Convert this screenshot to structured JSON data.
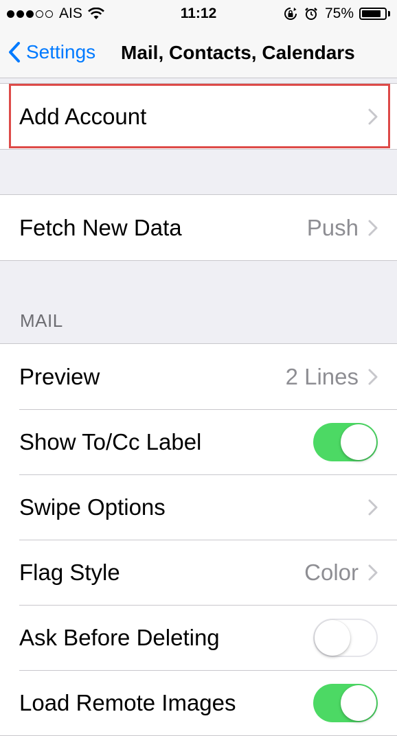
{
  "status_bar": {
    "carrier": "AIS",
    "time": "11:12",
    "battery": "75%",
    "signal_icon": "signal-dots",
    "wifi_icon": "wifi-icon",
    "lock_rotation_icon": "rotation-lock-icon",
    "alarm_icon": "alarm-icon"
  },
  "nav": {
    "back_label": "Settings",
    "title": "Mail, Contacts, Calendars"
  },
  "accounts": {
    "add_account": "Add Account"
  },
  "fetch": {
    "label": "Fetch New Data",
    "value": "Push"
  },
  "mail": {
    "header": "MAIL",
    "preview": {
      "label": "Preview",
      "value": "2 Lines"
    },
    "show_tocc": {
      "label": "Show To/Cc Label",
      "state": true
    },
    "swipe_options": {
      "label": "Swipe Options"
    },
    "flag_style": {
      "label": "Flag Style",
      "value": "Color"
    },
    "ask_before_deleting": {
      "label": "Ask Before Deleting",
      "state": false
    },
    "load_remote_images": {
      "label": "Load Remote Images",
      "state": true
    }
  },
  "colors": {
    "accent": "#007aff",
    "toggle_on": "#4cd964",
    "highlight": "#dd4a48"
  }
}
